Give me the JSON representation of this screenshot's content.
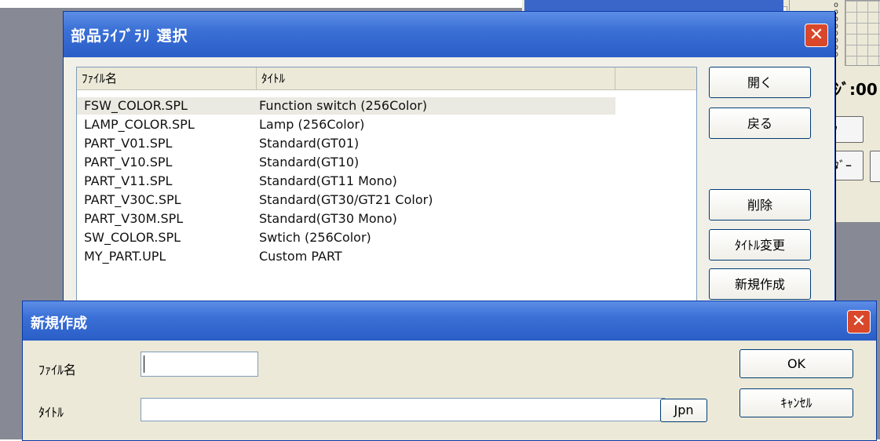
{
  "background": {
    "circles": "o\no\no\no\no\no\no\no",
    "partial_text": "ｼﾞ:00",
    "partial_btn_1": "ｸ",
    "partial_btn_2": "ﾀﾞｰ"
  },
  "library_dialog": {
    "title": "部品ﾗｲﾌﾞﾗﾘ 選択",
    "close_label": "✕",
    "columns": [
      "ﾌｧｲﾙ名",
      "ﾀｲﾄﾙ",
      ""
    ],
    "rows": [
      {
        "file": "FSW_COLOR.SPL",
        "title": "Function switch (256Color)"
      },
      {
        "file": "LAMP_COLOR.SPL",
        "title": "Lamp (256Color)"
      },
      {
        "file": "PART_V01.SPL",
        "title": "Standard(GT01)"
      },
      {
        "file": "PART_V10.SPL",
        "title": "Standard(GT10)"
      },
      {
        "file": "PART_V11.SPL",
        "title": "Standard(GT11 Mono)"
      },
      {
        "file": "PART_V30C.SPL",
        "title": "Standard(GT30/GT21 Color)"
      },
      {
        "file": "PART_V30M.SPL",
        "title": "Standard(GT30 Mono)"
      },
      {
        "file": "SW_COLOR.SPL",
        "title": "Swtich (256Color)"
      },
      {
        "file": "MY_PART.UPL",
        "title": "Custom  PART"
      }
    ],
    "buttons": {
      "open": "開く",
      "back": "戻る",
      "delete": "削除",
      "rename_title": "ﾀｲﾄﾙ変更",
      "new": "新規作成"
    }
  },
  "new_dialog": {
    "title": "新規作成",
    "close_label": "✕",
    "filename_label": "ﾌｧｲﾙ名",
    "filename_value": "",
    "title_label": "ﾀｲﾄﾙ",
    "title_value": "",
    "lang_button": "Jpn",
    "ok_button": "OK",
    "cancel_button": "ｷｬﾝｾﾙ"
  },
  "colors": {
    "titlebar": "#2a5ec7",
    "close": "#d9482b",
    "desktop": "#878a94"
  }
}
